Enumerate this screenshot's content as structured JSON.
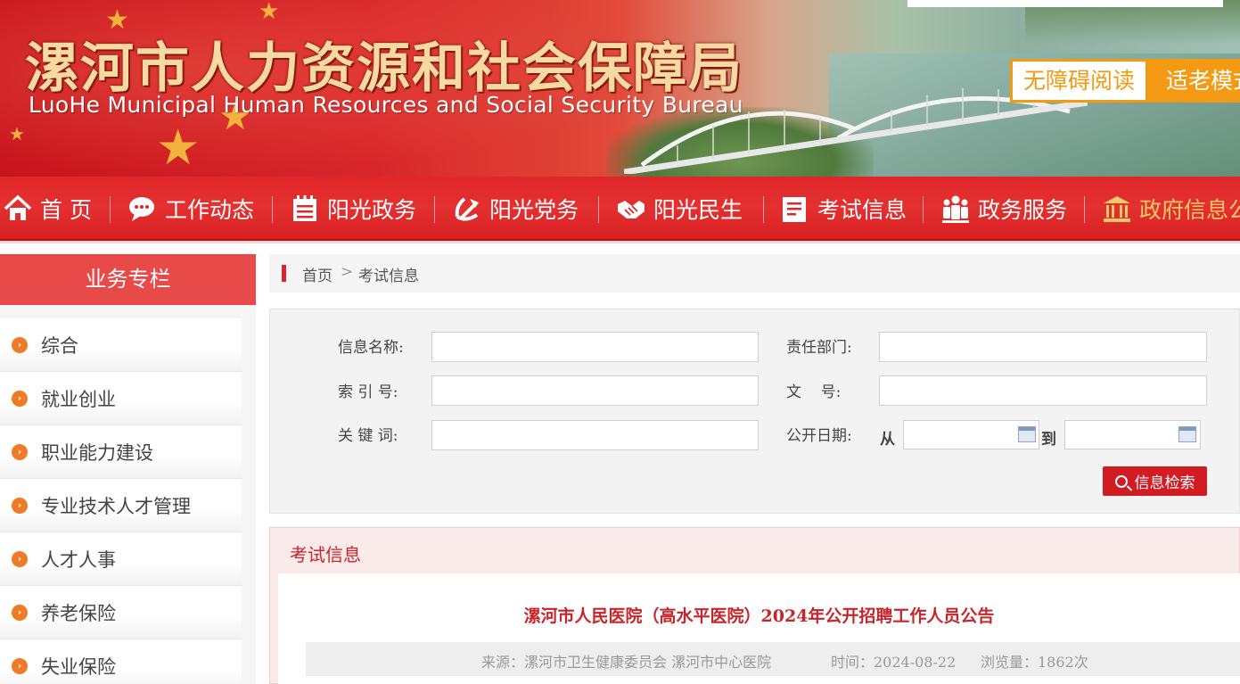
{
  "header": {
    "title_cn": "漯河市人力资源和社会保障局",
    "title_en": "LuoHe Municipal Human Resources and Social Security Bureau",
    "accessibility_button": "无障碍阅读",
    "elderly_mode_button": "适老模式"
  },
  "nav": {
    "items": [
      {
        "label": "首 页",
        "icon": "home-icon"
      },
      {
        "label": "工作动态",
        "icon": "chat-bubble-icon"
      },
      {
        "label": "阳光政务",
        "icon": "notepad-icon"
      },
      {
        "label": "阳光党务",
        "icon": "party-emblem-icon"
      },
      {
        "label": "阳光民生",
        "icon": "handshake-icon"
      },
      {
        "label": "考试信息",
        "icon": "document-icon"
      },
      {
        "label": "政务服务",
        "icon": "people-icon"
      },
      {
        "label": "政府信息公开",
        "icon": "government-building-icon"
      }
    ]
  },
  "sidebar": {
    "title": "业务专栏",
    "items": [
      {
        "label": "综合"
      },
      {
        "label": "就业创业"
      },
      {
        "label": "职业能力建设"
      },
      {
        "label": "专业技术人才管理"
      },
      {
        "label": "人才人事"
      },
      {
        "label": "养老保险"
      },
      {
        "label": "失业保险"
      }
    ]
  },
  "breadcrumb": {
    "home": "首页",
    "separator": ">",
    "current": "考试信息"
  },
  "search_form": {
    "info_name_label": "信息名称:",
    "info_name_value": "",
    "department_label": "责任部门:",
    "department_value": "",
    "index_label": "索 引 号:",
    "index_value": "",
    "doc_number_label": "文    号:",
    "doc_number_value": "",
    "keyword_label": "关 键 词:",
    "keyword_value": "",
    "date_label": "公开日期:",
    "date_from_label": "从",
    "date_from_value": "",
    "date_to_label": "到",
    "date_to_value": "",
    "search_button": "信息检索"
  },
  "info_panel": {
    "title": "考试信息",
    "article_title": "漯河市人民医院（高水平医院）2024年公开招聘工作人员公告",
    "source": "来源：漯河市卫生健康委员会 漯河市中心医院",
    "time": "时间：2024-08-22",
    "views": "浏览量：1862次"
  },
  "colors": {
    "nav_red": "#e0272a",
    "accent_orange": "#f39a12",
    "sidebar_head": "#e84a4a",
    "title_red": "#c8242a",
    "search_button": "#d21c23"
  }
}
